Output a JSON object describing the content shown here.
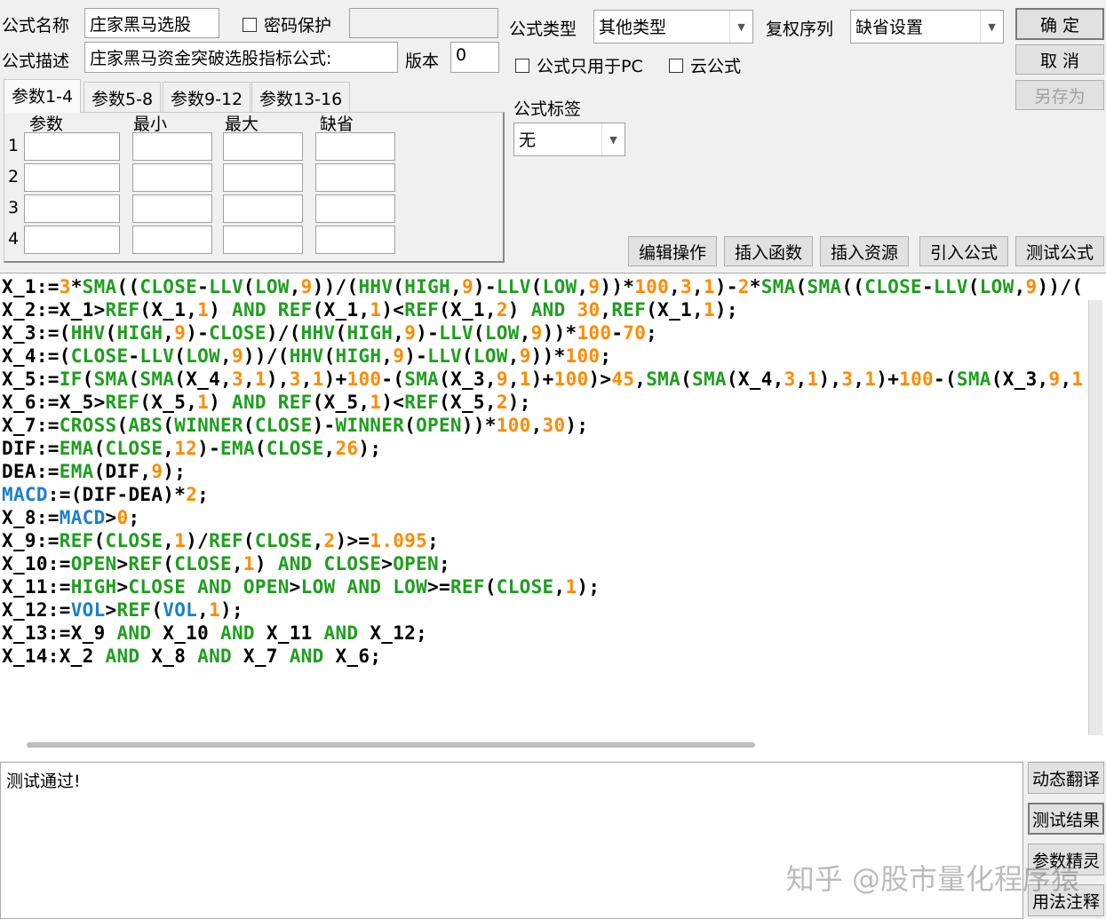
{
  "form": {
    "name_label": "公式名称",
    "name_value": "庄家黑马选股",
    "password_label": "密码保护",
    "desc_label": "公式描述",
    "desc_value": "庄家黑马资金突破选股指标公式:",
    "version_label": "版本",
    "version_value": "0",
    "type_label": "公式类型",
    "type_value": "其他类型",
    "rights_label": "复权序列",
    "rights_value": "缺省设置",
    "pc_only_label": "公式只用于PC",
    "cloud_label": "云公式",
    "tag_label": "公式标签",
    "tag_value": "无"
  },
  "buttons": {
    "ok": "确 定",
    "cancel": "取 消",
    "save_as": "另存为",
    "edit_ops": "编辑操作",
    "insert_func": "插入函数",
    "insert_res": "插入资源",
    "import_formula": "引入公式",
    "test_formula": "测试公式",
    "dyn_translate": "动态翻译",
    "test_result": "测试结果",
    "param_wizard": "参数精灵",
    "usage_notes": "用法注释"
  },
  "tabs": [
    "参数1-4",
    "参数5-8",
    "参数9-12",
    "参数13-16"
  ],
  "params": {
    "headers": [
      "参数",
      "最小",
      "最大",
      "缺省"
    ],
    "rows": [
      "1",
      "2",
      "3",
      "4"
    ]
  },
  "code": {
    "lines": [
      "X_1:=3*SMA((CLOSE-LLV(LOW,9))/(HHV(HIGH,9)-LLV(LOW,9))*100,3,1)-2*SMA(SMA((CLOSE-LLV(LOW,9))/(",
      "X_2:=X_1>REF(X_1,1) AND REF(X_1,1)<REF(X_1,2) AND 30,REF(X_1,1);",
      "X_3:=(HHV(HIGH,9)-CLOSE)/(HHV(HIGH,9)-LLV(LOW,9))*100-70;",
      "X_4:=(CLOSE-LLV(LOW,9))/(HHV(HIGH,9)-LLV(LOW,9))*100;",
      "X_5:=IF(SMA(SMA(X_4,3,1),3,1)+100-(SMA(X_3,9,1)+100)>45,SMA(SMA(X_4,3,1),3,1)+100-(SMA(X_3,9,1",
      "X_6:=X_5>REF(X_5,1) AND REF(X_5,1)<REF(X_5,2);",
      "X_7:=CROSS(ABS(WINNER(CLOSE)-WINNER(OPEN))*100,30);",
      "DIF:=EMA(CLOSE,12)-EMA(CLOSE,26);",
      "DEA:=EMA(DIF,9);",
      "MACD:=(DIF-DEA)*2;",
      "X_8:=MACD>0;",
      "X_9:=REF(CLOSE,1)/REF(CLOSE,2)>=1.095;",
      "X_10:=OPEN>REF(CLOSE,1) AND CLOSE>OPEN;",
      "X_11:=HIGH>CLOSE AND OPEN>LOW AND LOW>=REF(CLOSE,1);",
      "X_12:=VOL>REF(VOL,1);",
      "X_13:=X_9 AND X_10 AND X_11 AND X_12;",
      "X_14:X_2 AND X_8 AND X_7 AND X_6;"
    ],
    "colors": {
      "function": "#1e9e1e",
      "number": "#ff8a00",
      "variable": "#1a7fd0",
      "plain": "#000000"
    }
  },
  "output": {
    "text": "测试通过!"
  },
  "watermark": "知乎 @股市量化程序猿"
}
